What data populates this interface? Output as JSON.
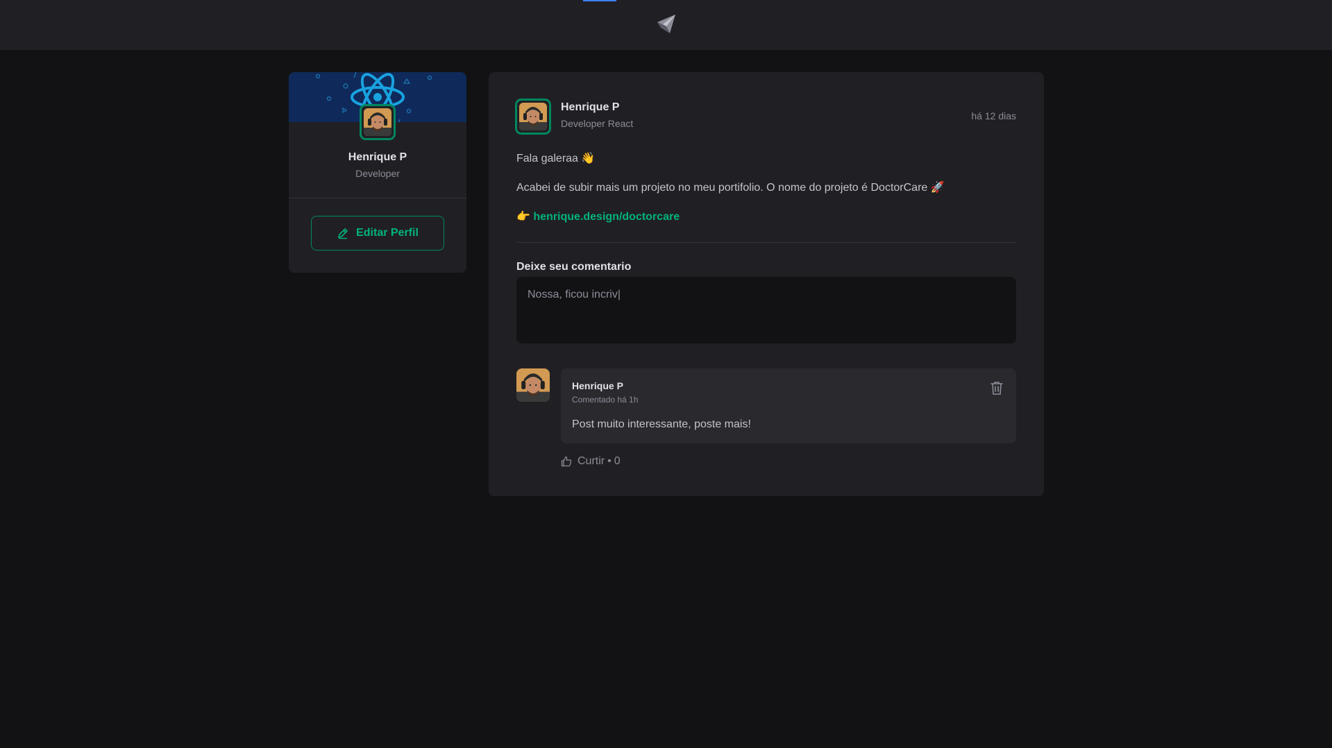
{
  "colors": {
    "background": "#121214",
    "surface": "#202024",
    "accent": "#00b37e",
    "accent_border": "#00875f",
    "cover": "#0f2a5a"
  },
  "header": {
    "logo_icon": "paper-plane-icon"
  },
  "sidebar": {
    "name": "Henrique P",
    "role": "Developer",
    "edit_button_label": "Editar Perfil",
    "edit_icon": "pencil-icon"
  },
  "post": {
    "author_name": "Henrique P",
    "author_role": "Developer React",
    "time": "há 12 dias",
    "line1": "Fala galeraa 👋",
    "line2": "Acabei de subir mais um projeto no meu portifolio. O nome do projeto é DoctorCare 🚀",
    "link_prefix": "👉",
    "link_text": "henrique.design/doctorcare",
    "comment_form_title": "Deixe seu comentario",
    "comment_input_value": "Nossa, ficou incriv|"
  },
  "comment": {
    "author": "Henrique P",
    "time": "Comentado há 1h",
    "text": "Post muito interessante, poste mais!",
    "like_label": "Curtir",
    "like_separator": "•",
    "like_count": "0"
  }
}
